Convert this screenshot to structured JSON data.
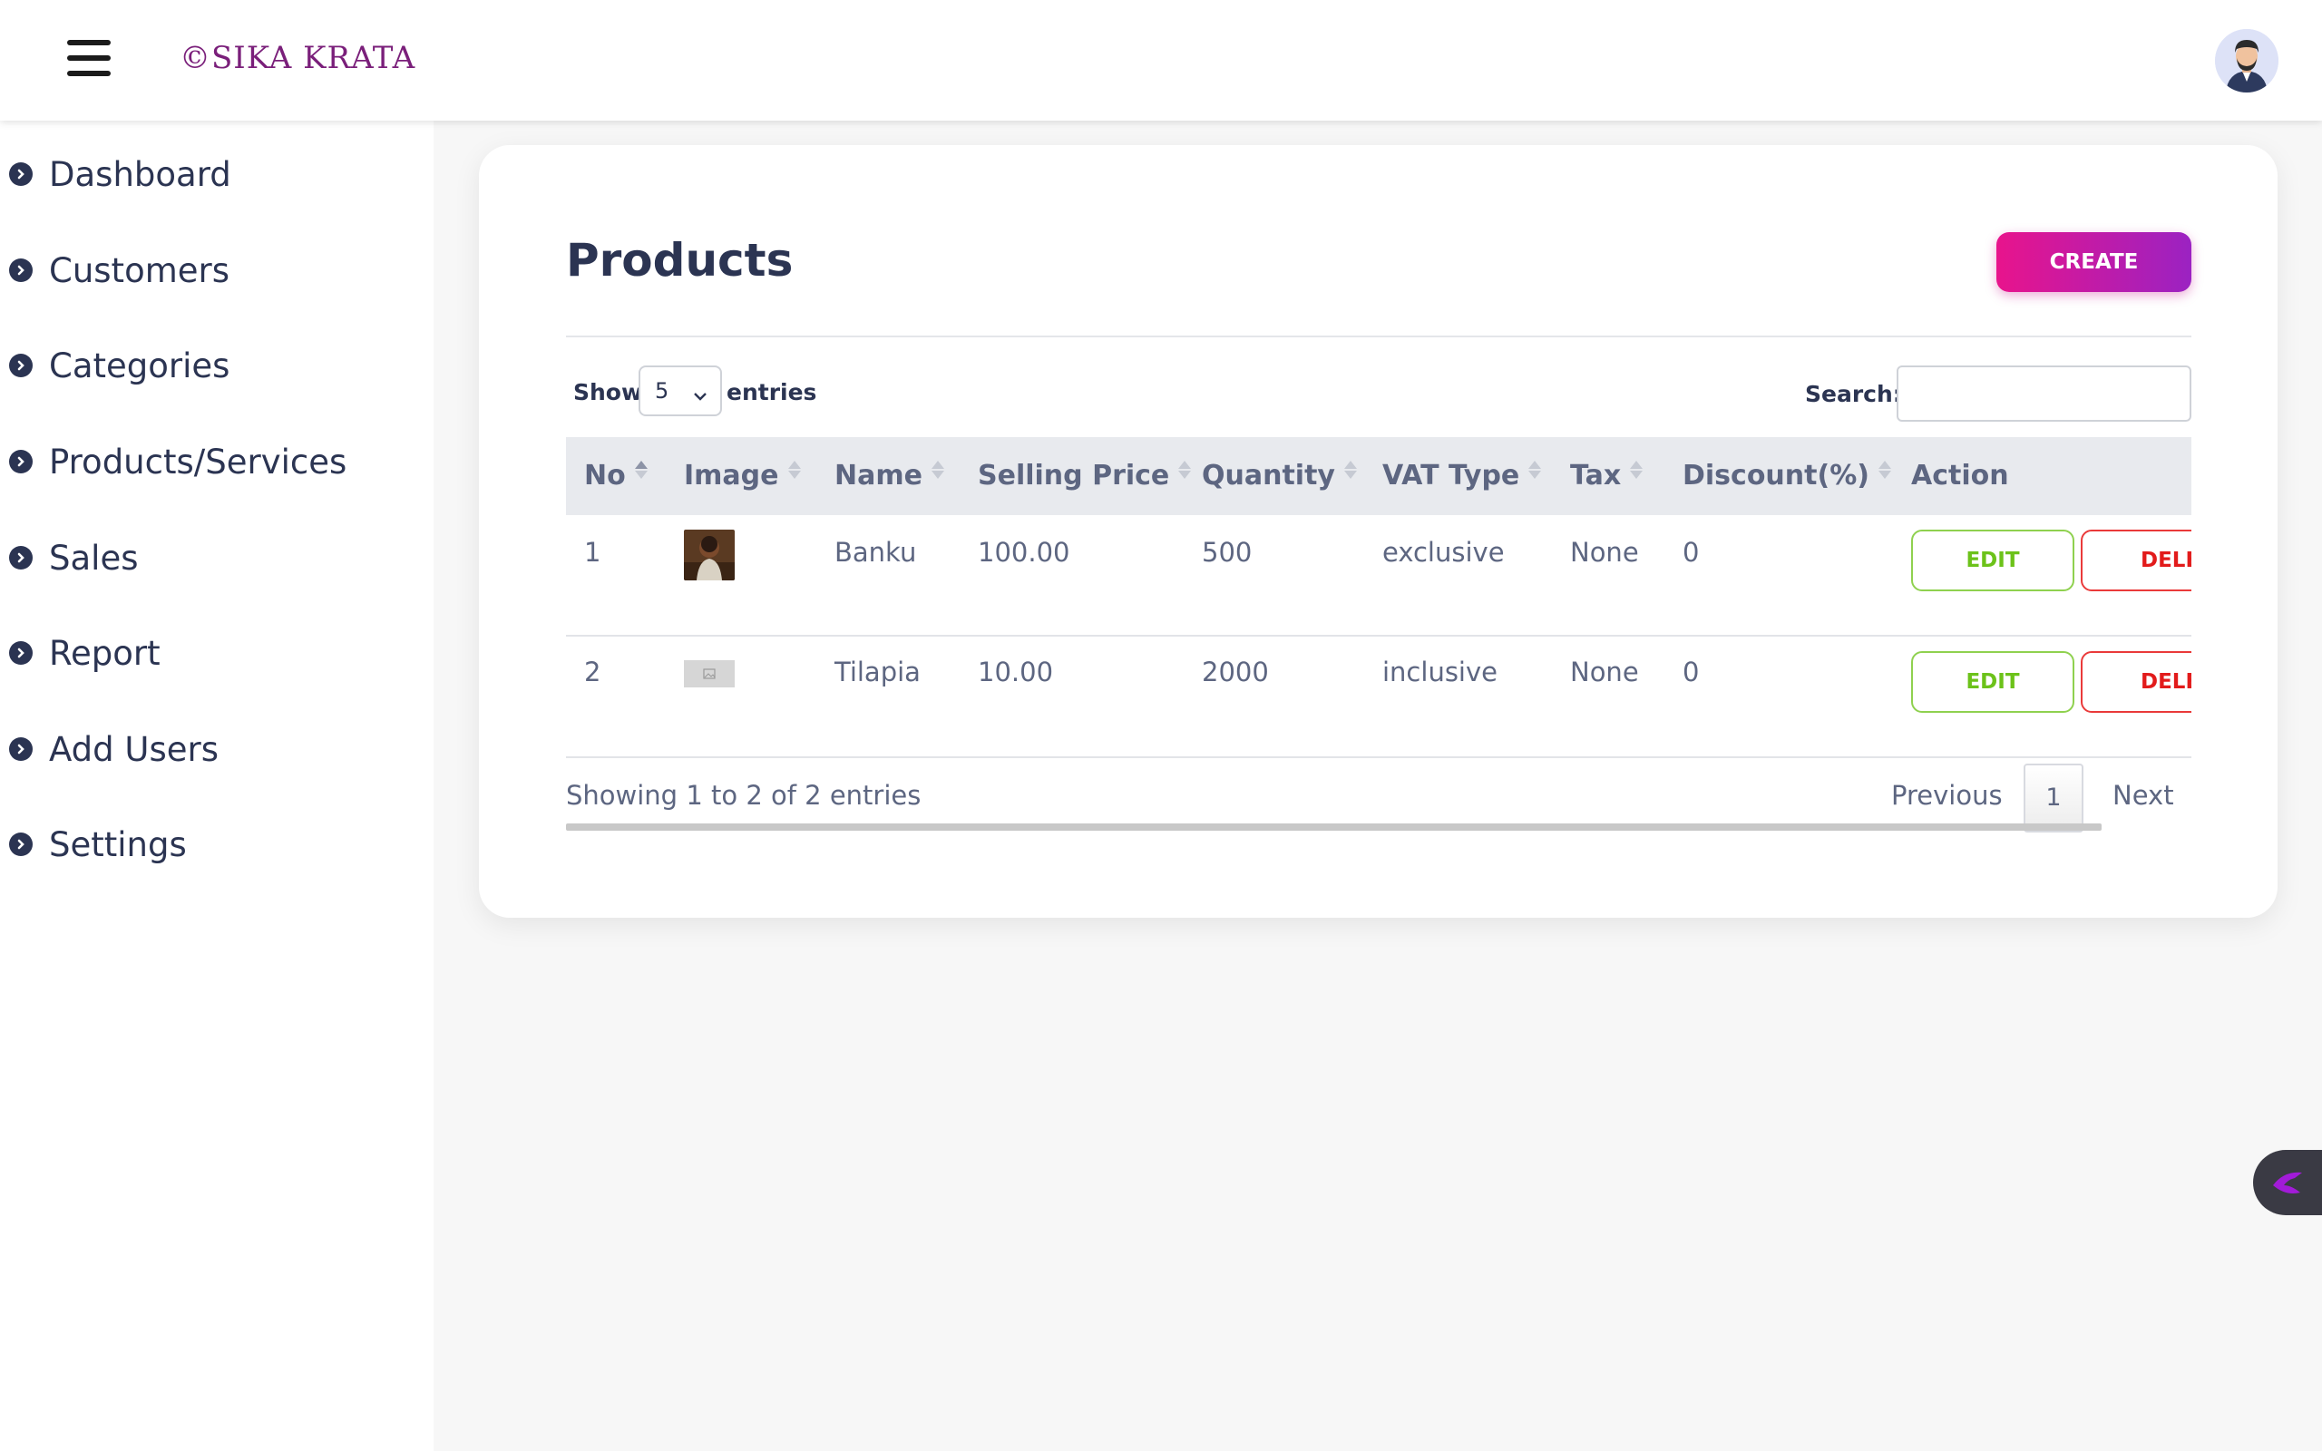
{
  "header": {
    "brand": "©SIKA KRATA"
  },
  "sidebar": {
    "items": [
      {
        "label": "Dashboard"
      },
      {
        "label": "Customers"
      },
      {
        "label": "Categories"
      },
      {
        "label": "Products/Services"
      },
      {
        "label": "Sales"
      },
      {
        "label": "Report"
      },
      {
        "label": "Add Users"
      },
      {
        "label": "Settings"
      }
    ]
  },
  "main": {
    "title": "Products",
    "create_label": "CREATE",
    "show_label": "Show",
    "entries_value": "5",
    "entries_label": "entries",
    "search_label": "Search:",
    "search_value": "",
    "columns": [
      "No",
      "Image",
      "Name",
      "Selling Price",
      "Quantity",
      "VAT Type",
      "Tax",
      "Discount(%)",
      "Action"
    ],
    "rows": [
      {
        "no": "1",
        "name": "Banku",
        "price": "100.00",
        "quantity": "500",
        "vat": "exclusive",
        "tax": "None",
        "discount": "0",
        "edit": "EDIT",
        "delete": "DELETE"
      },
      {
        "no": "2",
        "name": "Tilapia",
        "price": "10.00",
        "quantity": "2000",
        "vat": "inclusive",
        "tax": "None",
        "discount": "0",
        "edit": "EDIT",
        "delete": "DELETE"
      }
    ],
    "info": "Showing 1 to 2 of 2 entries",
    "pager": {
      "previous": "Previous",
      "page": "1",
      "next": "Next"
    }
  },
  "colors": {
    "accent_start": "#e8148c",
    "accent_end": "#9b22c2",
    "edit": "#6cc21a",
    "delete": "#e21b1b",
    "text": "#2b3452"
  }
}
